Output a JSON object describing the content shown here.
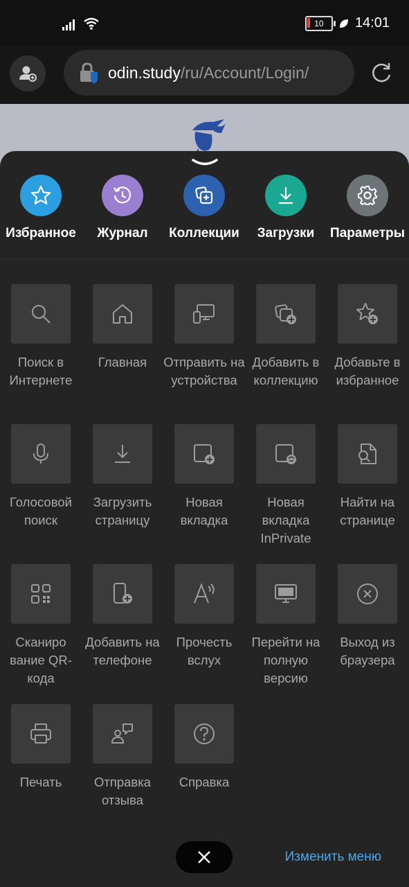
{
  "status": {
    "time": "14:01",
    "battery": "10"
  },
  "browser": {
    "url_host": "odin.study",
    "url_path": "/ru/Account/Login/"
  },
  "quick_actions": [
    {
      "label": "Избранное",
      "icon": "star-icon",
      "color": "#2b9fe0"
    },
    {
      "label": "Журнал",
      "icon": "history-icon",
      "color": "#9a7fd1"
    },
    {
      "label": "Коллекции",
      "icon": "collections-icon",
      "color": "#2d62b0"
    },
    {
      "label": "Загрузки",
      "icon": "download-icon",
      "color": "#1aa893"
    },
    {
      "label": "Параметры",
      "icon": "gear-icon",
      "color": "#6d7478"
    }
  ],
  "menu_items": [
    {
      "label": "Поиск в Интернете",
      "icon": "search-icon"
    },
    {
      "label": "Главная",
      "icon": "home-icon"
    },
    {
      "label": "Отправить на устройства",
      "icon": "send-to-device-icon"
    },
    {
      "label": "Добавить в коллекцию",
      "icon": "add-to-collection-icon"
    },
    {
      "label": "Добавьте в избранное",
      "icon": "add-favorite-icon"
    },
    {
      "label": "Голосовой поиск",
      "icon": "microphone-icon"
    },
    {
      "label": "Загрузить страницу",
      "icon": "download-page-icon"
    },
    {
      "label": "Новая вкладка",
      "icon": "new-tab-icon"
    },
    {
      "label": "Новая вкладка InPrivate",
      "icon": "inprivate-tab-icon"
    },
    {
      "label": "Найти на странице",
      "icon": "find-in-page-icon"
    },
    {
      "label": "Сканиро вание QR-кода",
      "icon": "qr-code-icon"
    },
    {
      "label": "Добавить на телефоне",
      "icon": "add-to-phone-icon"
    },
    {
      "label": "Прочесть вслух",
      "icon": "read-aloud-icon"
    },
    {
      "label": "Перейти на полную версию",
      "icon": "desktop-site-icon"
    },
    {
      "label": "Выход из браузера",
      "icon": "exit-icon"
    },
    {
      "label": "Печать",
      "icon": "print-icon"
    },
    {
      "label": "Отправка отзыва",
      "icon": "feedback-icon"
    },
    {
      "label": "Справка",
      "icon": "help-icon"
    }
  ],
  "footer": {
    "edit_menu_label": "Изменить меню",
    "link_color": "#4ea6e6"
  }
}
